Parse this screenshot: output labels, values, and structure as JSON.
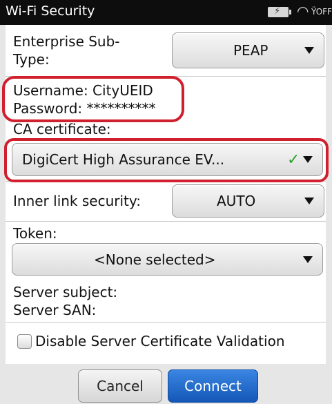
{
  "statusbar": {
    "title": "Wi-Fi Security",
    "battery_icon": "battery-charging-icon",
    "wifi_icon": "wifi-signal-icon",
    "network_indicator": "OFF"
  },
  "form": {
    "enterprise_subtype": {
      "label_line1": "Enterprise Sub-",
      "label_line2": "Type:",
      "value": "PEAP"
    },
    "username": "Username: CityUEID",
    "password": "Password: **********",
    "ca_certificate": {
      "label": "CA certificate:",
      "value": "DigiCert High Assurance EV...",
      "status_icon": "checkmark-icon"
    },
    "inner_link_security": {
      "label": "Inner link security:",
      "value": "AUTO"
    },
    "token": {
      "label": "Token:",
      "value": "<None selected>"
    },
    "server_subject": {
      "label": "Server subject:"
    },
    "server_san": {
      "label": "Server SAN:"
    },
    "disable_validation": {
      "label": "Disable Server Certificate Validation",
      "checked": false
    }
  },
  "buttons": {
    "cancel": "Cancel",
    "connect": "Connect"
  },
  "highlight_color": "#d0202f",
  "accent_color": "#1a5fc0"
}
